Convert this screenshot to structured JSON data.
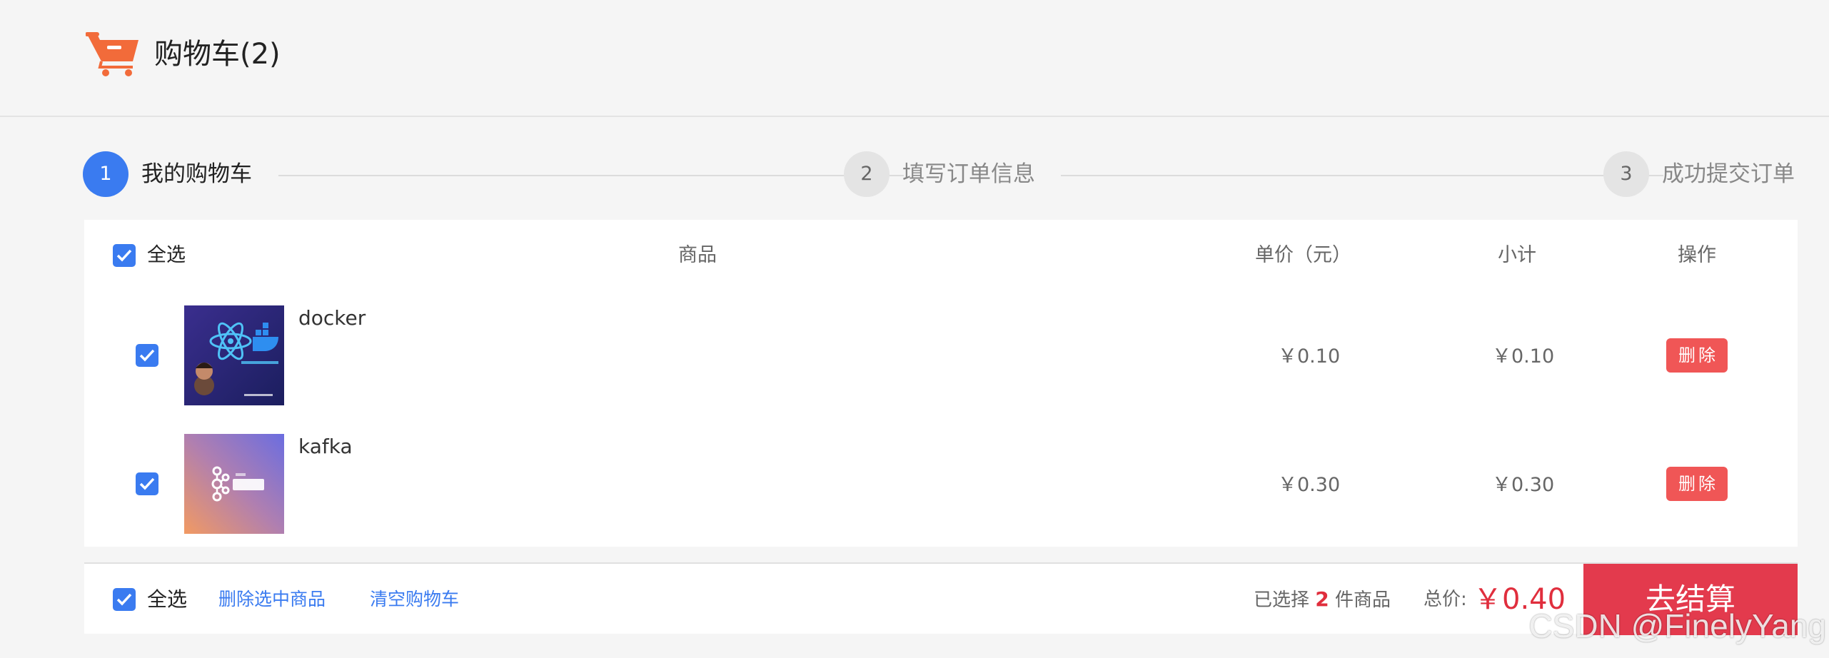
{
  "header": {
    "title": "购物车(2)"
  },
  "steps": [
    {
      "number": "1",
      "label": "我的购物车",
      "active": true
    },
    {
      "number": "2",
      "label": "填写订单信息",
      "active": false
    },
    {
      "number": "3",
      "label": "成功提交订单",
      "active": false
    }
  ],
  "table": {
    "select_all": "全选",
    "col_product": "商品",
    "col_price": "单价（元）",
    "col_subtotal": "小计",
    "col_action": "操作"
  },
  "items": [
    {
      "name": "docker",
      "price": "￥0.10",
      "subtotal": "￥0.10",
      "delete": "删除",
      "checked": true
    },
    {
      "name": "kafka",
      "price": "￥0.30",
      "subtotal": "￥0.30",
      "delete": "删除",
      "checked": true
    }
  ],
  "footer": {
    "select_all": "全选",
    "delete_selected": "删除选中商品",
    "clear_cart": "清空购物车",
    "selected_prefix": "已选择",
    "selected_count": "2",
    "selected_suffix": "件商品",
    "total_label": "总价:",
    "total_value": "￥0.40",
    "checkout": "去结算"
  },
  "watermark": "CSDN @FinelyYang",
  "colors": {
    "primary": "#3a7bf0",
    "danger": "#e33a4d",
    "delete": "#f05656",
    "cart_icon": "#f26b3a"
  }
}
